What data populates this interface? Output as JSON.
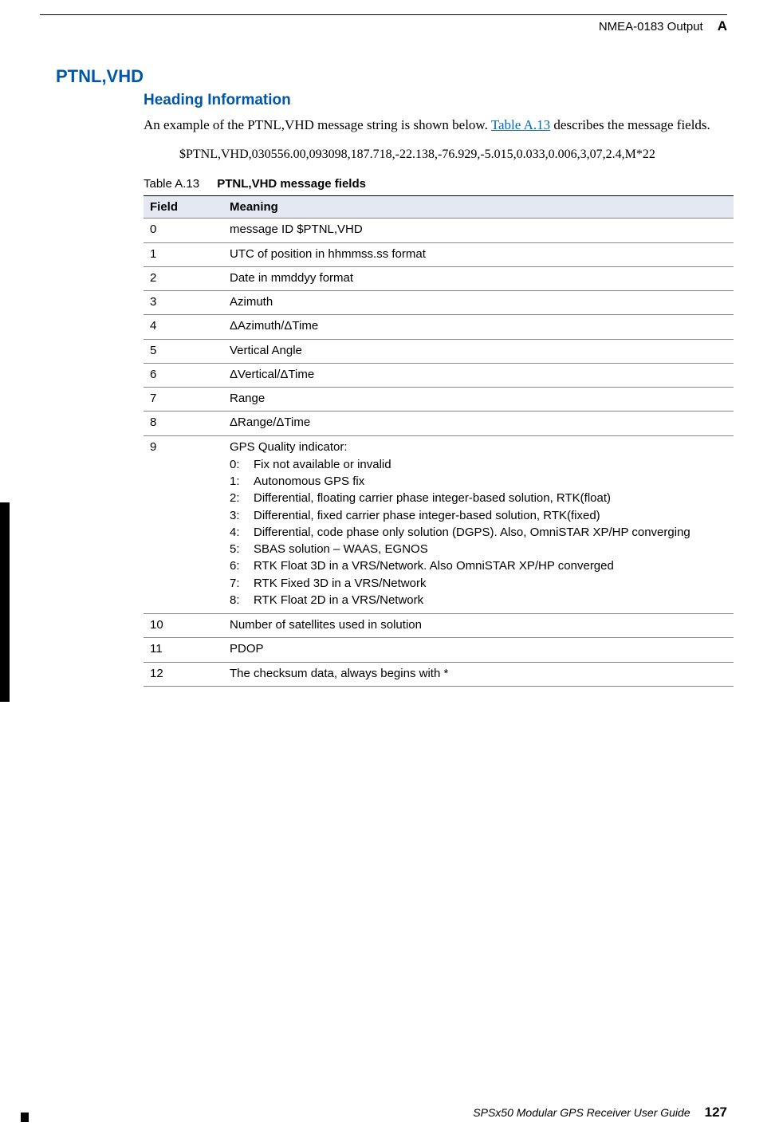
{
  "header": {
    "chapter_title": "NMEA-0183 Output",
    "appendix_letter": "A"
  },
  "h1": "PTNL,VHD",
  "h2": "Heading Information",
  "intro": {
    "pre": "An example of the PTNL,VHD message string is shown below. ",
    "link": "Table A.13",
    "post": " describes the message fields."
  },
  "code": "$PTNL,VHD,030556.00,093098,187.718,-22.138,-76.929,-5.015,0.033,0.006,3,07,2.4,M*22",
  "table": {
    "number": "Table A.13",
    "title": "PTNL,VHD message fields",
    "col_field": "Field",
    "col_meaning": "Meaning",
    "rows": [
      {
        "field": "0",
        "meaning": "message ID $PTNL,VHD"
      },
      {
        "field": "1",
        "meaning": "UTC of position in hhmmss.ss format"
      },
      {
        "field": "2",
        "meaning": "Date in mmddyy format"
      },
      {
        "field": "3",
        "meaning": "Azimuth"
      },
      {
        "field": "4",
        "meaning": "ΔAzimuth/ΔTime"
      },
      {
        "field": "5",
        "meaning": "Vertical Angle"
      },
      {
        "field": "6",
        "meaning": "ΔVertical/ΔTime"
      },
      {
        "field": "7",
        "meaning": "Range"
      },
      {
        "field": "8",
        "meaning": "ΔRange/ΔTime"
      },
      {
        "field": "9",
        "meaning": "GPS Quality indicator:",
        "sublist": [
          {
            "n": "0:",
            "t": "Fix not available or invalid"
          },
          {
            "n": "1:",
            "t": "Autonomous GPS fix"
          },
          {
            "n": "2:",
            "t": "Differential, floating carrier phase integer-based solution, RTK(float)"
          },
          {
            "n": "3:",
            "t": "Differential, fixed carrier phase integer-based solution, RTK(fixed)"
          },
          {
            "n": "4:",
            "t": "Differential, code phase only solution (DGPS). Also, OmniSTAR XP/HP converging"
          },
          {
            "n": "5:",
            "t": "SBAS solution – WAAS, EGNOS"
          },
          {
            "n": "6:",
            "t": "RTK Float 3D in a VRS/Network. Also OmniSTAR XP/HP converged"
          },
          {
            "n": "7:",
            "t": "RTK Fixed 3D in a VRS/Network"
          },
          {
            "n": "8:",
            "t": "RTK Float 2D in a VRS/Network"
          }
        ]
      },
      {
        "field": "10",
        "meaning": "Number of satellites used in solution"
      },
      {
        "field": "11",
        "meaning": "PDOP"
      },
      {
        "field": "12",
        "meaning": "The checksum data, always begins with *"
      }
    ]
  },
  "footer": {
    "title": "SPSx50 Modular GPS Receiver User Guide",
    "page": "127"
  }
}
